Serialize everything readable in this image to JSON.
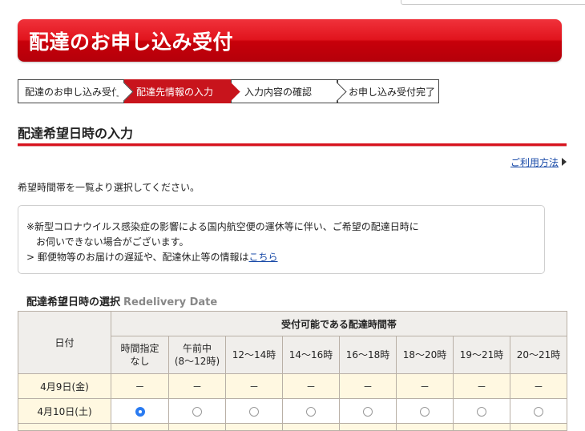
{
  "banner": {
    "title": "配達のお申し込み受付"
  },
  "steps": [
    {
      "label": "配達のお申し込み受付"
    },
    {
      "label": "配達先情報の入力"
    },
    {
      "label": "入力内容の確認"
    },
    {
      "label": "お申し込み受付完了"
    }
  ],
  "section": {
    "title": "配達希望日時の入力"
  },
  "help": {
    "label": "ご利用方法"
  },
  "intro": "希望時間帯を一覧より選択してください。",
  "notice": {
    "line1": "※新型コロナウイルス感染症の影響による国内航空便の運休等に伴い、ご希望の配達日時に",
    "line2": "お伺いできない場合がございます。",
    "line3_prefix": "> 郵便物等のお届けの遅延や、配達休止等の情報は",
    "line3_link": "こちら"
  },
  "table": {
    "title": "配達希望日時の選択",
    "title_en": "Redelivery Date",
    "date_header": "日付",
    "group_header": "受付可能である配達時間帯",
    "slots": [
      {
        "line1": "時間指定",
        "line2": "なし"
      },
      {
        "line1": "午前中",
        "line2": "(8〜12時)"
      },
      {
        "line1": "12〜14時",
        "line2": ""
      },
      {
        "line1": "14〜16時",
        "line2": ""
      },
      {
        "line1": "16〜18時",
        "line2": ""
      },
      {
        "line1": "18〜20時",
        "line2": ""
      },
      {
        "line1": "19〜21時",
        "line2": ""
      },
      {
        "line1": "20〜21時",
        "line2": ""
      }
    ],
    "rows": [
      {
        "date": "4月9日(金)",
        "unavailable_mark": "－"
      },
      {
        "date": "4月10日(土)",
        "selected_slot": "時間指定なし"
      }
    ]
  },
  "colors": {
    "accent": "#d7141e",
    "link": "#1a4ba8",
    "radio_selected": "#2a7bf1"
  }
}
